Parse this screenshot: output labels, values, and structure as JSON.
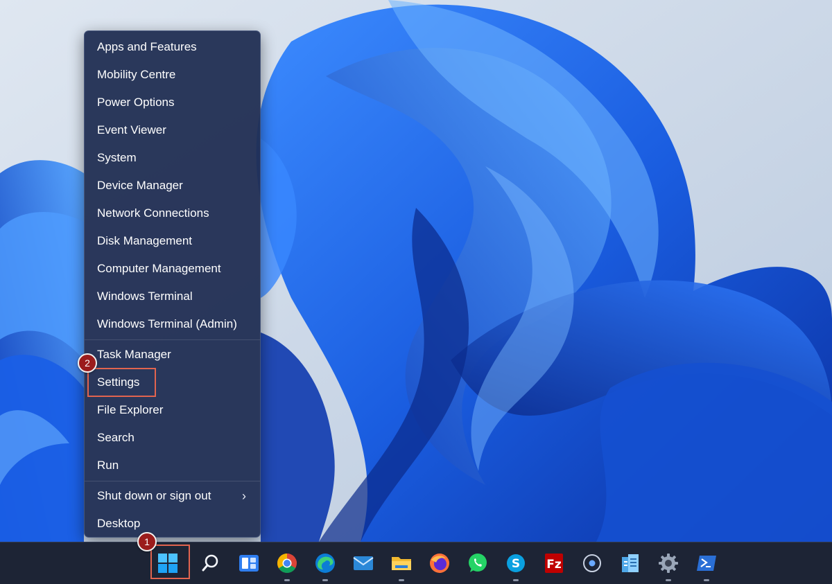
{
  "context_menu": {
    "items": [
      {
        "label": "Apps and Features"
      },
      {
        "label": "Mobility Centre"
      },
      {
        "label": "Power Options"
      },
      {
        "label": "Event Viewer"
      },
      {
        "label": "System"
      },
      {
        "label": "Device Manager"
      },
      {
        "label": "Network Connections"
      },
      {
        "label": "Disk Management"
      },
      {
        "label": "Computer Management"
      },
      {
        "label": "Windows Terminal"
      },
      {
        "label": "Windows Terminal (Admin)"
      },
      {
        "label": "Task Manager"
      },
      {
        "label": "Settings"
      },
      {
        "label": "File Explorer"
      },
      {
        "label": "Search"
      },
      {
        "label": "Run"
      },
      {
        "label": "Shut down or sign out",
        "chevron": "›"
      },
      {
        "label": "Desktop"
      }
    ]
  },
  "annotations": {
    "step1": "1",
    "step2": "2",
    "highlight_color": "#e2644f",
    "badge_color": "#9b1c1c"
  },
  "taskbar": {
    "icons": [
      "windows-start-icon",
      "search-icon",
      "widgets-icon",
      "chrome-icon",
      "edge-icon",
      "mail-icon",
      "file-explorer-icon",
      "firefox-icon",
      "whatsapp-icon",
      "skype-icon",
      "filezilla-icon",
      "circle-app-icon",
      "server-app-icon",
      "settings-icon",
      "powershell-icon"
    ]
  }
}
